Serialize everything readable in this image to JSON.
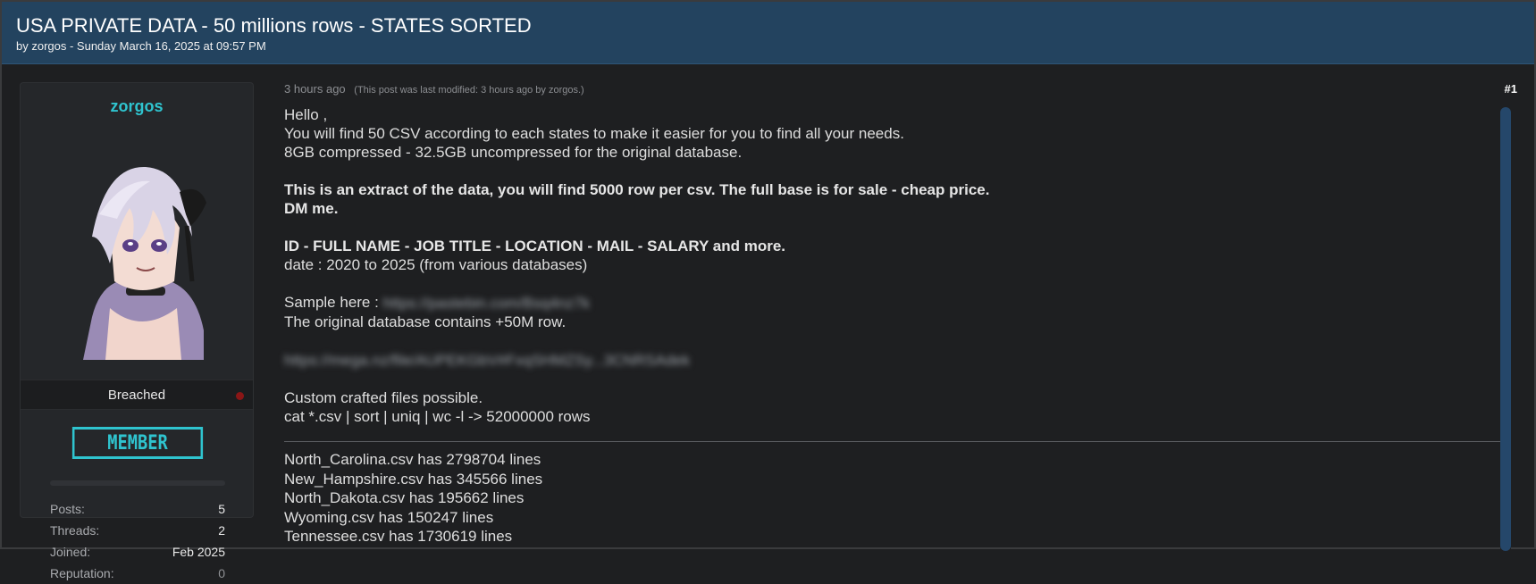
{
  "thread": {
    "title": "USA PRIVATE DATA - 50 millions rows - STATES SORTED",
    "meta": "by zorgos - Sunday March 16, 2025 at 09:57 PM"
  },
  "author": {
    "name": "zorgos",
    "rank": "Breached",
    "badge": "MEMBER",
    "stats": [
      {
        "label": "Posts:",
        "value": "5"
      },
      {
        "label": "Threads:",
        "value": "2"
      },
      {
        "label": "Joined:",
        "value": "Feb 2025"
      },
      {
        "label": "Reputation:",
        "value": "0"
      }
    ]
  },
  "post": {
    "time": "3 hours ago",
    "modified": "(This post was last modified: 3 hours ago by zorgos.)",
    "number": "#1",
    "lines": {
      "l1": "Hello ,",
      "l2": "You will find 50 CSV according to each states to make it easier for you to find all your needs.",
      "l3": "8GB compressed - 32.5GB uncompressed for the original database.",
      "l4": "This is an extract of the data, you will find 5000 row per csv. The full base is for sale - cheap price.",
      "l5": "DM me.",
      "l6": "ID - FULL NAME - JOB TITLE - LOCATION - MAIL - SALARY and more.",
      "l7": "date : 2020 to 2025 (from various databases)",
      "l8": "Sample here :",
      "l8_link": "https://pastebin.com/Bsq4nz7k",
      "l9": "The original database contains +50M row.",
      "l10_link": "https://mega.nz/file/AUPEKGbV#FxqSHMZSy...3CNRSAdek",
      "l11": "Custom crafted files possible.",
      "l12": "cat *.csv | sort | uniq | wc -l -> 52000000 rows"
    },
    "files": [
      "North_Carolina.csv has 2798704 lines",
      "New_Hampshire.csv has 345566 lines",
      "North_Dakota.csv has 195662 lines",
      "Wyoming.csv has 150247 lines",
      "Tennessee.csv has 1730619 lines"
    ]
  },
  "colors": {
    "header_bg": "#23435f",
    "accent": "#2fc4cf",
    "status_offline": "#8a1616"
  }
}
